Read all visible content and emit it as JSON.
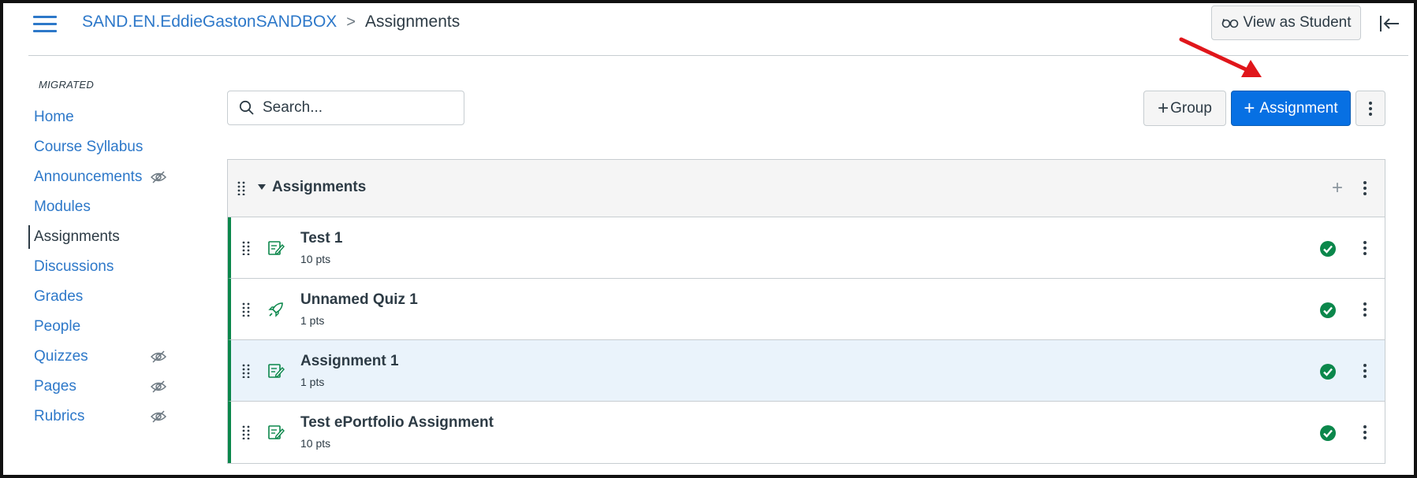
{
  "header": {
    "course_link": "SAND.EN.EddieGastonSANDBOX",
    "separator": ">",
    "current_page": "Assignments",
    "view_as_student": "View as Student"
  },
  "sidebar": {
    "section_label": "MIGRATED",
    "items": [
      {
        "label": "Home",
        "hidden": false,
        "active": false
      },
      {
        "label": "Course Syllabus",
        "hidden": false,
        "active": false
      },
      {
        "label": "Announcements",
        "hidden": true,
        "active": false
      },
      {
        "label": "Modules",
        "hidden": false,
        "active": false
      },
      {
        "label": "Assignments",
        "hidden": false,
        "active": true
      },
      {
        "label": "Discussions",
        "hidden": false,
        "active": false
      },
      {
        "label": "Grades",
        "hidden": false,
        "active": false
      },
      {
        "label": "People",
        "hidden": false,
        "active": false
      },
      {
        "label": "Quizzes",
        "hidden": true,
        "active": false
      },
      {
        "label": "Pages",
        "hidden": true,
        "active": false
      },
      {
        "label": "Rubrics",
        "hidden": true,
        "active": false
      }
    ]
  },
  "toolbar": {
    "search_placeholder": "Search...",
    "group_button": "Group",
    "assignment_button": "Assignment"
  },
  "group": {
    "title": "Assignments",
    "items": [
      {
        "title": "Test 1",
        "points": "10 pts",
        "type": "assignment-icon",
        "published": true,
        "highlighted": false
      },
      {
        "title": "Unnamed Quiz 1",
        "points": "1 pts",
        "type": "quiz-rocket-icon",
        "published": true,
        "highlighted": false
      },
      {
        "title": "Assignment 1",
        "points": "1 pts",
        "type": "assignment-icon",
        "published": true,
        "highlighted": true
      },
      {
        "title": "Test ePortfolio Assignment",
        "points": "10 pts",
        "type": "assignment-icon",
        "published": true,
        "highlighted": false
      }
    ]
  },
  "colors": {
    "link": "#2d78c9",
    "primary_button": "#0770e3",
    "published_green": "#0b874b",
    "annotation_arrow": "#e0161b",
    "highlight_row": "#eaf3fb"
  }
}
